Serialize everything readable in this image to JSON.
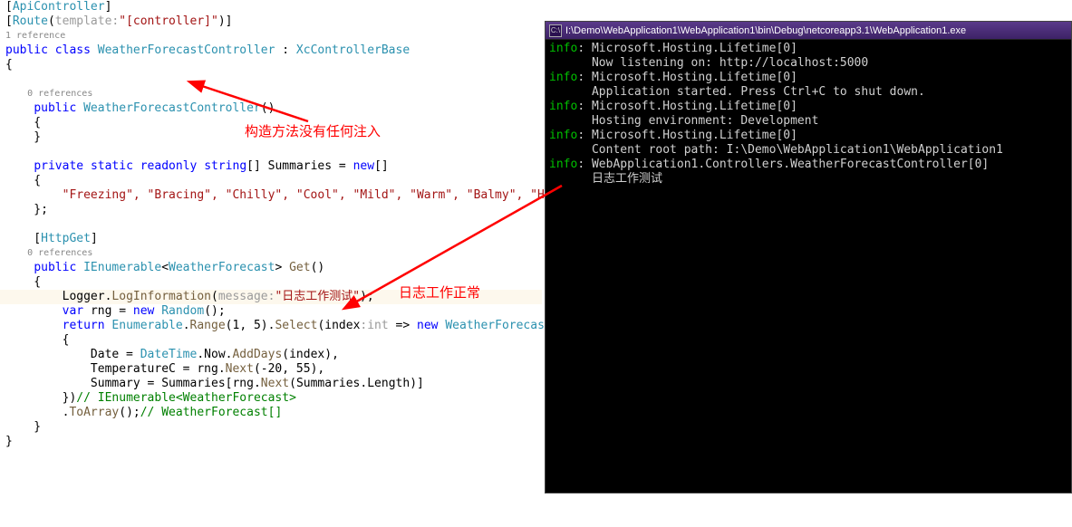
{
  "editor": {
    "attr_api": "ApiController",
    "attr_route": "Route",
    "template_label": "template:",
    "route_val": "\"[controller]\"",
    "ref1": "1 reference",
    "kw_public": "public",
    "kw_class": "class",
    "cls_name": "WeatherForecastController",
    "base": "XcControllerBase",
    "ref0": "0 references",
    "ctor": "WeatherForecastController",
    "kw_private": "private",
    "kw_static": "static",
    "kw_readonly": "readonly",
    "kw_string": "string",
    "summaries": "Summaries",
    "kw_new": "new",
    "arr": "\"Freezing\", \"Bracing\", \"Chilly\", \"Cool\", \"Mild\", \"Warm\", \"Balmy\", \"Hot\", \"Sw",
    "httpget": "HttpGet",
    "ienum": "IEnumerable",
    "wf": "WeatherForecast",
    "get": "Get",
    "logger": "Logger",
    "loginfo": "LogInformation",
    "msg_label": "message:",
    "msg_val": "\"日志工作测试\"",
    "kw_var": "var",
    "rng": "rng",
    "random": "Random",
    "kw_return": "return",
    "enumerable": "Enumerable",
    "range": "Range",
    "range_args": "(1, 5)",
    "select": "Select",
    "index": "index",
    "int_hint": ":int",
    "date": "Date",
    "datetime": "DateTime",
    "now": "Now",
    "adddays": "AddDays",
    "tempc": "TemperatureC",
    "next_args": "(-20, 55)",
    "summary": "Summary",
    "length": "Length",
    "next": "Next",
    "cmt1": "// IEnumerable<WeatherForecast>",
    "toarray": "ToArray",
    "cmt2": "// WeatherForecast[]"
  },
  "console": {
    "title": "I:\\Demo\\WebApplication1\\WebApplication1\\bin\\Debug\\netcoreapp3.1\\WebApplication1.exe",
    "icon": "C:\\",
    "lines": [
      {
        "p": "info",
        "s": ": Microsoft.Hosting.Lifetime[0]"
      },
      {
        "p": "    ",
        "s": "  Now listening on: http://localhost:5000"
      },
      {
        "p": "info",
        "s": ": Microsoft.Hosting.Lifetime[0]"
      },
      {
        "p": "    ",
        "s": "  Application started. Press Ctrl+C to shut down."
      },
      {
        "p": "info",
        "s": ": Microsoft.Hosting.Lifetime[0]"
      },
      {
        "p": "    ",
        "s": "  Hosting environment: Development"
      },
      {
        "p": "info",
        "s": ": Microsoft.Hosting.Lifetime[0]"
      },
      {
        "p": "    ",
        "s": "  Content root path: I:\\Demo\\WebApplication1\\WebApplication1"
      },
      {
        "p": "info",
        "s": ": WebApplication1.Controllers.WeatherForecastController[0]"
      },
      {
        "p": "    ",
        "s": "  日志工作测试"
      }
    ]
  },
  "annotations": {
    "a1": "构造方法没有任何注入",
    "a2": "日志工作正常"
  }
}
